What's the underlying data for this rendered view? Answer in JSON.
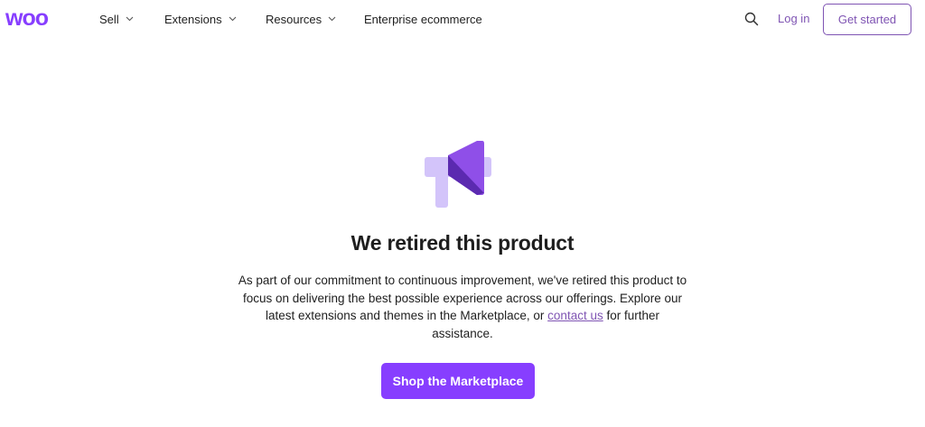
{
  "header": {
    "logo_text": "woo",
    "nav": [
      {
        "label": "Sell",
        "has_dropdown": true
      },
      {
        "label": "Extensions",
        "has_dropdown": true
      },
      {
        "label": "Resources",
        "has_dropdown": true
      },
      {
        "label": "Enterprise ecommerce",
        "has_dropdown": false
      }
    ],
    "search_icon": "search-icon",
    "login_label": "Log in",
    "get_started_label": "Get started"
  },
  "main": {
    "illustration_icon": "megaphone-icon",
    "heading": "We retired this product",
    "paragraph_before_link": "As part of our commitment to continuous improvement, we've retired this product to focus on delivering the best possible experience across our offerings. Explore our latest extensions and themes in the Marketplace, or ",
    "link_label": "contact us",
    "paragraph_after_link": " for further assistance.",
    "cta_label": "Shop the Marketplace"
  },
  "colors": {
    "brand_purple": "#7f54b3",
    "cta_purple": "#873eff",
    "megaphone_dark": "#5b2ab0",
    "megaphone_mid": "#8f4fe8",
    "megaphone_light": "#d3c4fa",
    "text": "#1e1e1e"
  }
}
